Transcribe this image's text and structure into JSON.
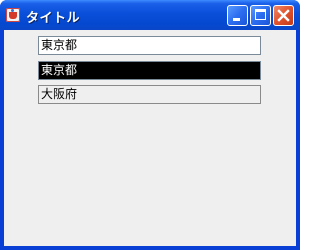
{
  "window": {
    "title": "タイトル",
    "icons": {
      "app": "java-cup-icon",
      "minimize": "minimize-icon",
      "maximize": "maximize-icon",
      "close": "close-icon"
    },
    "colors": {
      "titlebar": "#0a4fd9",
      "close_button": "#e0532d",
      "client_background": "#efefef"
    }
  },
  "form": {
    "field1": {
      "value": "東京都",
      "state": "editable"
    },
    "field2": {
      "value": "東京都",
      "state": "selected"
    },
    "field3": {
      "value": "大阪府",
      "state": "disabled"
    }
  }
}
